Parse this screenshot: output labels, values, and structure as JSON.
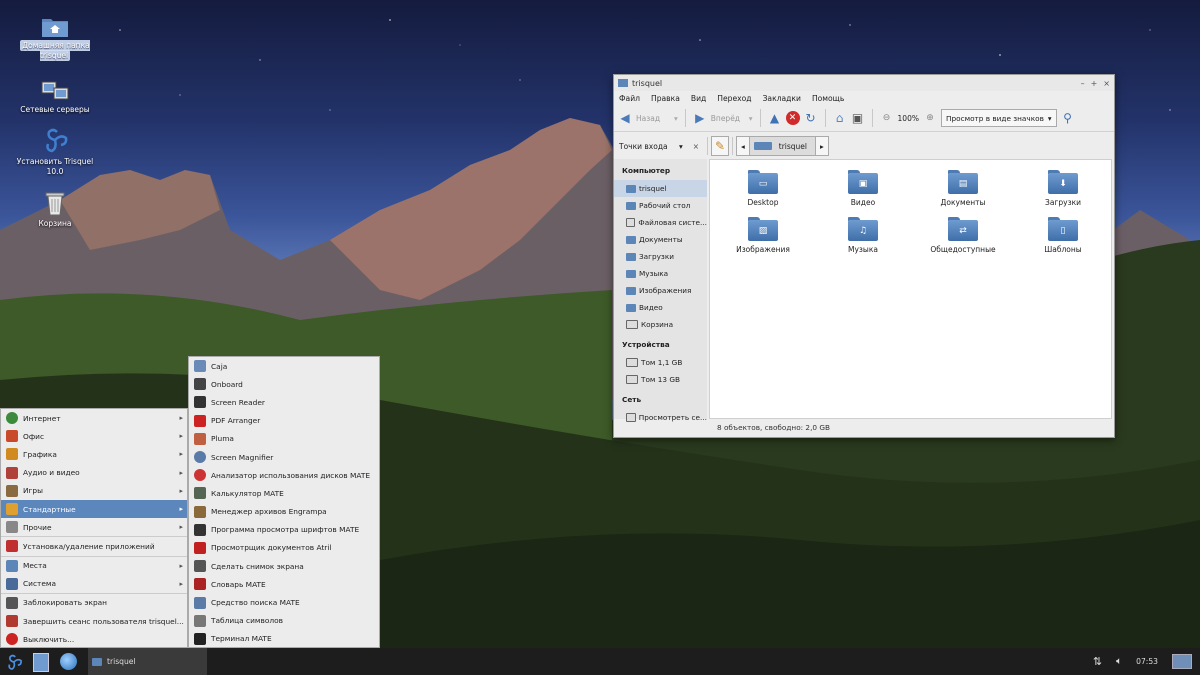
{
  "desktop": {
    "icons": [
      {
        "label": "Домашняя папка trisquel",
        "icon": "home-folder-icon"
      },
      {
        "label": "Сетевые серверы",
        "icon": "network-servers-icon"
      },
      {
        "label": "Установить Trisquel 10.0",
        "icon": "trisquel-install-icon"
      },
      {
        "label": "Корзина",
        "icon": "trash-icon"
      }
    ]
  },
  "file_manager": {
    "title": "trisquel",
    "menu": [
      "Файл",
      "Правка",
      "Вид",
      "Переход",
      "Закладки",
      "Помощь"
    ],
    "toolbar": {
      "back_label": "Назад",
      "forward_label": "Вперёд",
      "zoom": "100%",
      "view_mode": "Просмотр в виде значков"
    },
    "sidebar_selector": "Точки входа",
    "location": "trisquel",
    "sidebar": {
      "computer_header": "Компьютер",
      "computer_items": [
        "trisquel",
        "Рабочий стол",
        "Файловая систе...",
        "Документы",
        "Загрузки",
        "Музыка",
        "Изображения",
        "Видео",
        "Корзина"
      ],
      "devices_header": "Устройства",
      "devices_items": [
        "Том 1,1 GB",
        "Том 13 GB"
      ],
      "network_header": "Сеть",
      "network_items": [
        "Просмотреть се..."
      ]
    },
    "files": [
      {
        "name": "Desktop",
        "glyph": "▭"
      },
      {
        "name": "Видео",
        "glyph": "▣"
      },
      {
        "name": "Документы",
        "glyph": "▤"
      },
      {
        "name": "Загрузки",
        "glyph": "⬇"
      },
      {
        "name": "Изображения",
        "glyph": "▨"
      },
      {
        "name": "Музыка",
        "glyph": "♫"
      },
      {
        "name": "Общедоступные",
        "glyph": "⇄"
      },
      {
        "name": "Шаблоны",
        "glyph": "▯"
      }
    ],
    "status": "8 объектов, свободно: 2,0 GB"
  },
  "app_menu": {
    "items": [
      {
        "label": "Интернет",
        "arrow": "▸",
        "color": "#3c8a3c"
      },
      {
        "label": "Офис",
        "arrow": "▸",
        "color": "#c94a2a"
      },
      {
        "label": "Графика",
        "arrow": "▸",
        "color": "#d08a20"
      },
      {
        "label": "Аудио и видео",
        "arrow": "▸",
        "color": "#b0403a"
      },
      {
        "label": "Игры",
        "arrow": "▸",
        "color": "#8a6a40"
      },
      {
        "label": "Стандартные",
        "arrow": "▸",
        "color": "#e0a030"
      },
      {
        "label": "Прочие",
        "arrow": "▸",
        "color": "#888888"
      },
      {
        "label": "Установка/удаление приложений",
        "arrow": "",
        "color": "#c03030"
      },
      {
        "label": "Места",
        "arrow": "▸",
        "color": "#5c86b8"
      },
      {
        "label": "Система",
        "arrow": "▸",
        "color": "#4a6a9a"
      },
      {
        "label": "Заблокировать экран",
        "arrow": "",
        "color": "#555555"
      },
      {
        "label": "Завершить сеанс пользователя trisquel...",
        "arrow": "",
        "color": "#b03a30"
      },
      {
        "label": "Выключить...",
        "arrow": "",
        "color": "#cc2222"
      }
    ],
    "submenu": [
      {
        "label": "Caja",
        "color": "#6a8ab8"
      },
      {
        "label": "Onboard",
        "color": "#444444"
      },
      {
        "label": "Screen Reader",
        "color": "#333333"
      },
      {
        "label": "PDF Arranger",
        "color": "#cc2222"
      },
      {
        "label": "Pluma",
        "color": "#c06040"
      },
      {
        "label": "Screen Magnifier",
        "color": "#5a7aa8"
      },
      {
        "label": "Анализатор использования дисков MATE",
        "color": "#cc3333"
      },
      {
        "label": "Калькулятор MATE",
        "color": "#556655"
      },
      {
        "label": "Менеджер архивов Engrampa",
        "color": "#8a6a3a"
      },
      {
        "label": "Программа просмотра шрифтов MATE",
        "color": "#333333"
      },
      {
        "label": "Просмотрщик документов Atril",
        "color": "#c02020"
      },
      {
        "label": "Сделать снимок экрана",
        "color": "#555555"
      },
      {
        "label": "Словарь MATE",
        "color": "#aa2222"
      },
      {
        "label": "Средство поиска MATE",
        "color": "#5a7aa8"
      },
      {
        "label": "Таблица символов",
        "color": "#777777"
      },
      {
        "label": "Терминал MATE",
        "color": "#222222"
      }
    ]
  },
  "panel": {
    "task_label": "trisquel",
    "clock": "07:53"
  }
}
